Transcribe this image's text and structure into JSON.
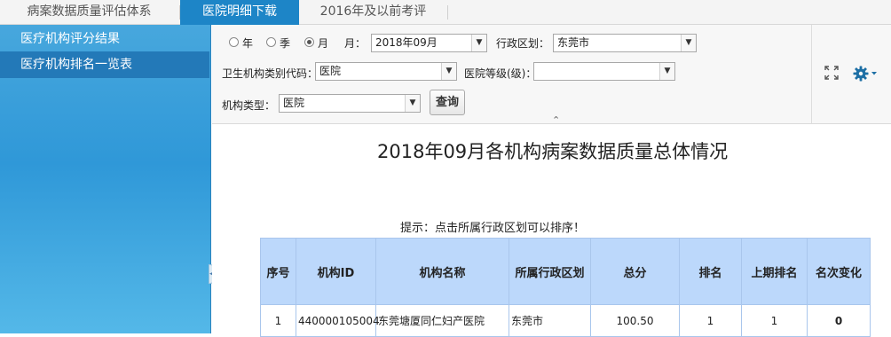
{
  "top_tabs": [
    {
      "label": "病案数据质量评估体系",
      "active": false
    },
    {
      "label": "医院明细下载",
      "active": true
    },
    {
      "label": "2016年及以前考评",
      "active": false
    }
  ],
  "sidebar": {
    "items": [
      {
        "label": "医疗机构评分结果",
        "active": false
      },
      {
        "label": "医疗机构排名一览表",
        "active": true
      }
    ]
  },
  "filters": {
    "period_options": [
      "年",
      "季",
      "月"
    ],
    "selected_period": "月",
    "month_label": "月：",
    "month_value": "2018年09月",
    "region_label": "行政区划：",
    "region_value": "东莞市",
    "category_label": "卫生机构类别代码：",
    "category_value": "医院",
    "grade_label": "医院等级(级)：",
    "grade_value": "",
    "type_label": "机构类型：",
    "type_value": "医院",
    "query_button": "查询"
  },
  "icons": {
    "fullscreen": "expand-icon",
    "settings": "gear-icon",
    "collapse_panel": "chevron-up-icon",
    "collapse_sidebar": "chevron-left-icon"
  },
  "report": {
    "title": "2018年09月各机构病案数据质量总体情况",
    "hint": "提示：点击所属行政区划可以排序！",
    "columns": [
      "序号",
      "机构ID",
      "机构名称",
      "所属行政区划",
      "总分",
      "排名",
      "上期排名",
      "名次变化"
    ],
    "rows": [
      {
        "seq": "1",
        "org_id": "440000105004",
        "name": "东莞塘厦同仁妇产医院",
        "region": "东莞市",
        "score": "100.50",
        "rank": "1",
        "prev_rank": "1",
        "change": "0"
      }
    ]
  },
  "colors": {
    "accent": "#1d85c7",
    "table_header": "#bcd8fb",
    "positive_change": "#3fb53f"
  }
}
